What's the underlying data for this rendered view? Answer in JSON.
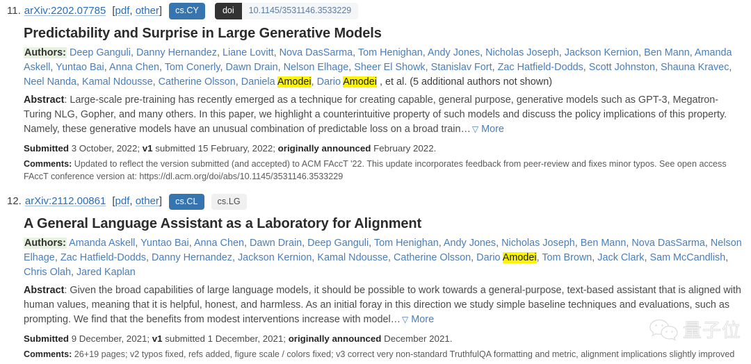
{
  "entries": [
    {
      "index": "11.",
      "arxiv_id": "arXiv:2202.07785",
      "format_open": "[",
      "format_pdf": "pdf",
      "format_comma": ", ",
      "format_other": "other",
      "format_close": "]",
      "primary_tag": "cs.CY",
      "doi_label": "doi",
      "doi_value": "10.1145/3531146.3533229",
      "title": "Predictability and Surprise in Large Generative Models",
      "authors_label": "Authors:",
      "authors": [
        "Deep Ganguli",
        "Danny Hernandez",
        "Liane Lovitt",
        "Nova DasSarma",
        "Tom Henighan",
        "Andy Jones",
        "Nicholas Joseph",
        "Jackson Kernion",
        "Ben Mann",
        "Amanda Askell",
        "Yuntao Bai",
        "Anna Chen",
        "Tom Conerly",
        "Dawn Drain",
        "Nelson Elhage",
        "Sheer El Showk",
        "Stanislav Fort",
        "Zac Hatfield-Dodds",
        "Scott Johnston",
        "Shauna Kravec",
        "Neel Nanda",
        "Kamal Ndousse",
        "Catherine Olsson",
        "Daniela Amodei",
        "Dario Amodei"
      ],
      "authors_suffix": ", et al. (5 additional authors not shown)",
      "abstract_label": "Abstract",
      "abstract_text": ": Large-scale pre-training has recently emerged as a technique for creating capable, general purpose, generative models such as GPT-3, Megatron-Turing NLG, Gopher, and many others. In this paper, we highlight a counterintuitive property of such models and discuss the policy implications of this property. Namely, these generative models have an unusual combination of predictable loss on a broad train…",
      "more_label": "More",
      "submitted_label": "Submitted",
      "submitted_date": "3 October, 2022;",
      "version_label": "v1",
      "version_text": "submitted 15 February, 2022;",
      "announced_label": "originally announced",
      "announced_date": "February 2022.",
      "comments_label": "Comments:",
      "comments_text": "Updated to reflect the version submitted (and accepted) to ACM FAccT '22. This update incorporates feedback from peer-review and fixes minor typos. See open access FAccT conference version at: https://dl.acm.org/doi/abs/10.1145/3531146.3533229"
    },
    {
      "index": "12.",
      "arxiv_id": "arXiv:2112.00861",
      "format_open": "[",
      "format_pdf": "pdf",
      "format_comma": ", ",
      "format_other": "other",
      "format_close": "]",
      "primary_tag": "cs.CL",
      "secondary_tag": "cs.LG",
      "title": "A General Language Assistant as a Laboratory for Alignment",
      "authors_label": "Authors:",
      "authors": [
        "Amanda Askell",
        "Yuntao Bai",
        "Anna Chen",
        "Dawn Drain",
        "Deep Ganguli",
        "Tom Henighan",
        "Andy Jones",
        "Nicholas Joseph",
        "Ben Mann",
        "Nova DasSarma",
        "Nelson Elhage",
        "Zac Hatfield-Dodds",
        "Danny Hernandez",
        "Jackson Kernion",
        "Kamal Ndousse",
        "Catherine Olsson",
        "Dario Amodei",
        "Tom Brown",
        "Jack Clark",
        "Sam McCandlish",
        "Chris Olah",
        "Jared Kaplan"
      ],
      "authors_suffix": "",
      "abstract_label": "Abstract",
      "abstract_text": ": Given the broad capabilities of large language models, it should be possible to work towards a general-purpose, text-based assistant that is aligned with human values, meaning that it is helpful, honest, and harmless. As an initial foray in this direction we study simple baseline techniques and evaluations, such as prompting. We find that the benefits from modest interventions increase with model…",
      "more_label": "More",
      "submitted_label": "Submitted",
      "submitted_date": "9 December, 2021;",
      "version_label": "v1",
      "version_text": "submitted 1 December, 2021;",
      "announced_label": "originally announced",
      "announced_date": "December 2021.",
      "comments_label": "Comments:",
      "comments_text": "26+19 pages; v2 typos fixed, refs added, figure scale / colors fixed; v3 correct very non-standard TruthfulQA formatting and metric, alignment implications slightly improved"
    }
  ],
  "highlight_term": "Amodei",
  "watermark": {
    "icon": "wechat-icon",
    "text": "量子位"
  },
  "colors": {
    "link": "#2a6ebb",
    "author_link": "#4a7ebb",
    "tag_primary_bg": "#3775b0",
    "tag_muted_bg": "#f0f0f0",
    "doi_label_bg": "#333333",
    "highlight": "#fcf500",
    "authors_label_bg": "#e8f2e0"
  }
}
